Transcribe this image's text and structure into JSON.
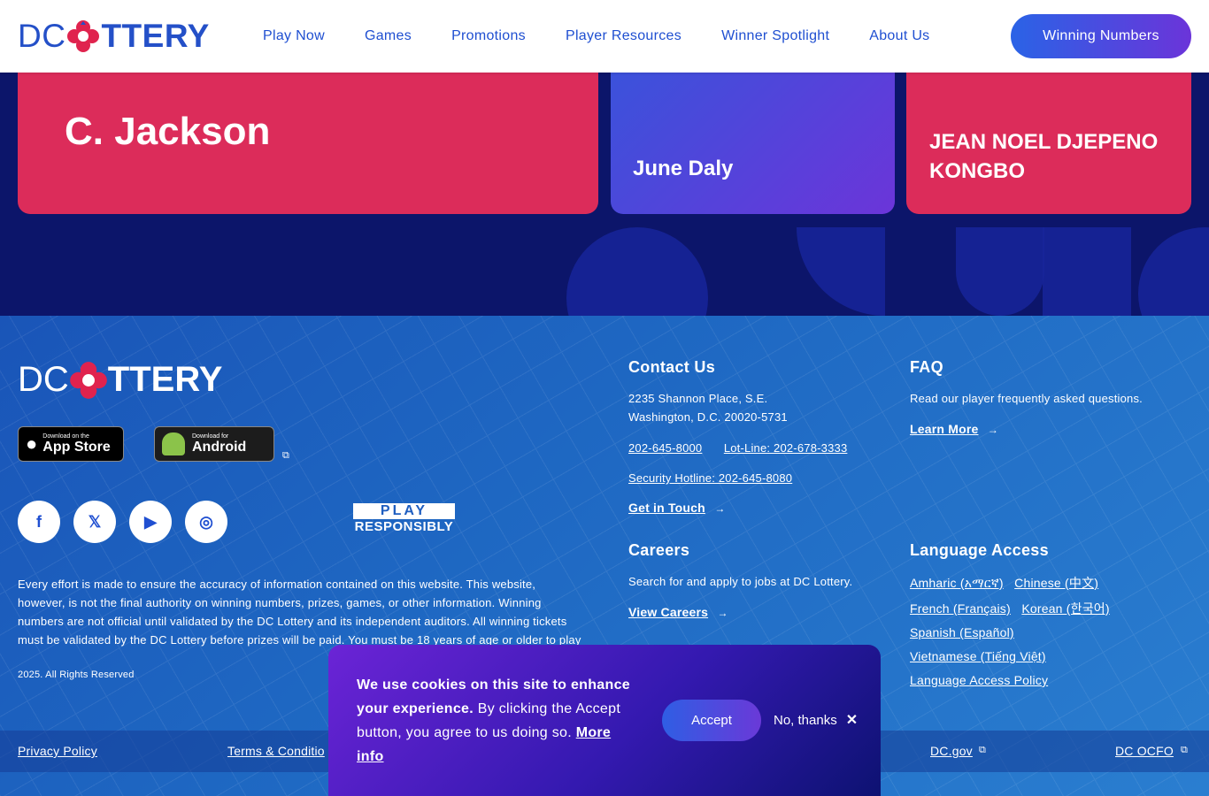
{
  "header": {
    "logo_dc": "DC",
    "logo_text": "TTERY",
    "logo_l": "L",
    "nav": [
      "Play Now",
      "Games",
      "Promotions",
      "Player Resources",
      "Winner Spotlight",
      "About Us"
    ],
    "cta": "Winning Numbers"
  },
  "winners": [
    {
      "name": "C. Jackson"
    },
    {
      "name": "June Daly"
    },
    {
      "name": "JEAN NOEL DJEPENO KONGBO"
    }
  ],
  "footer": {
    "logo_dc": "DC",
    "logo_l": "L",
    "logo_text": "TTERY",
    "apple_small": "Download on the",
    "apple_large": "App Store",
    "android_small": "Download for",
    "android_large": "Android",
    "social": [
      {
        "icon": "facebook-icon",
        "glyph": "f"
      },
      {
        "icon": "x-icon",
        "glyph": "𝕏"
      },
      {
        "icon": "youtube-icon",
        "glyph": "▶"
      },
      {
        "icon": "instagram-icon",
        "glyph": "◎"
      }
    ],
    "play_top": "PLAY",
    "play_bottom": "RESPONSIBLY",
    "disclaimer": "Every effort is made to ensure the accuracy of information contained on this website. This website, however, is not the final authority on winning numbers, prizes, games, or other information. Winning numbers are not official until validated by the DC Lottery and its independent auditors. All winning tickets must be validated by the DC Lottery before prizes will be paid. You must be 18 years of age or older to play",
    "rights": "2025. All Rights Reserved",
    "contact": {
      "title": "Contact Us",
      "addr1": "2235 Shannon Place, S.E.",
      "addr2": "Washington, D.C. 20020-5731",
      "phone": "202-645-8000",
      "lotline": "Lot-Line: 202-678-3333",
      "security": "Security Hotline: 202-645-8080",
      "link": "Get in Touch"
    },
    "faq": {
      "title": "FAQ",
      "text": "Read our player frequently asked questions.",
      "link": "Learn More"
    },
    "careers": {
      "title": "Careers",
      "text": "Search for and apply to jobs at DC Lottery.",
      "link": "View Careers"
    },
    "language": {
      "title": "Language Access",
      "amharic": "Amharic (አማርኛ)",
      "chinese": "Chinese (中文)",
      "french": "French (Français)",
      "korean": "Korean (한국어)",
      "spanish": "Spanish (Español)",
      "vietnamese": "Vietnamese (Tiếng Việt)",
      "policy": "Language Access Policy"
    },
    "bottom": {
      "privacy": "Privacy Policy",
      "terms": "Terms & Conditio",
      "dcgov": "DC.gov",
      "ocfo": "DC OCFO"
    }
  },
  "cookie": {
    "bold": "We use cookies on this site to enhance your experience.",
    "text": " By clicking the Accept button, you agree to us doing so. ",
    "more": "More info",
    "accept": "Accept",
    "decline": "No, thanks"
  },
  "colors": {
    "brand_blue": "#1f4fd1",
    "brand_red": "#dc2c5a",
    "navy": "#0c156a",
    "purple": "#6b35d9"
  }
}
